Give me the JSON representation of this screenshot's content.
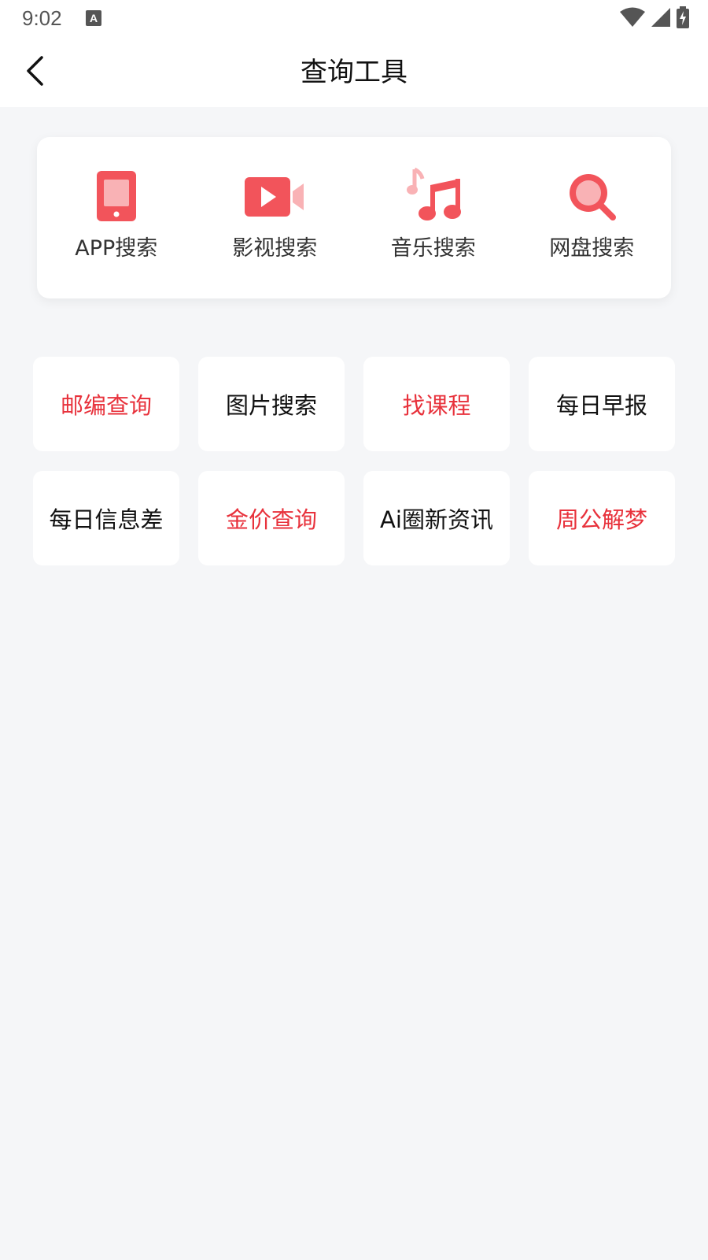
{
  "status_bar": {
    "time": "9:02",
    "notification_icon": "A",
    "icons": [
      "wifi-icon",
      "cell-signal-icon",
      "battery-charging-icon"
    ]
  },
  "header": {
    "title": "查询工具",
    "back_icon": "chevron-left-icon"
  },
  "colors": {
    "accent": "#f2545b",
    "accent_light": "#f9b2b5",
    "highlight_text": "#e8323c",
    "background": "#f5f6f8"
  },
  "quick_tools": [
    {
      "label": "APP搜索",
      "icon": "tablet-icon"
    },
    {
      "label": "影视搜索",
      "icon": "video-camera-icon"
    },
    {
      "label": "音乐搜索",
      "icon": "music-note-icon"
    },
    {
      "label": "网盘搜索",
      "icon": "search-icon"
    }
  ],
  "tools": [
    {
      "label": "邮编查询",
      "highlighted": true
    },
    {
      "label": "图片搜索",
      "highlighted": false
    },
    {
      "label": "找课程",
      "highlighted": true
    },
    {
      "label": "每日早报",
      "highlighted": false
    },
    {
      "label": "每日信息差",
      "highlighted": false
    },
    {
      "label": "金价查询",
      "highlighted": true
    },
    {
      "label": "Ai圈新资讯",
      "highlighted": false
    },
    {
      "label": "周公解梦",
      "highlighted": true
    }
  ]
}
